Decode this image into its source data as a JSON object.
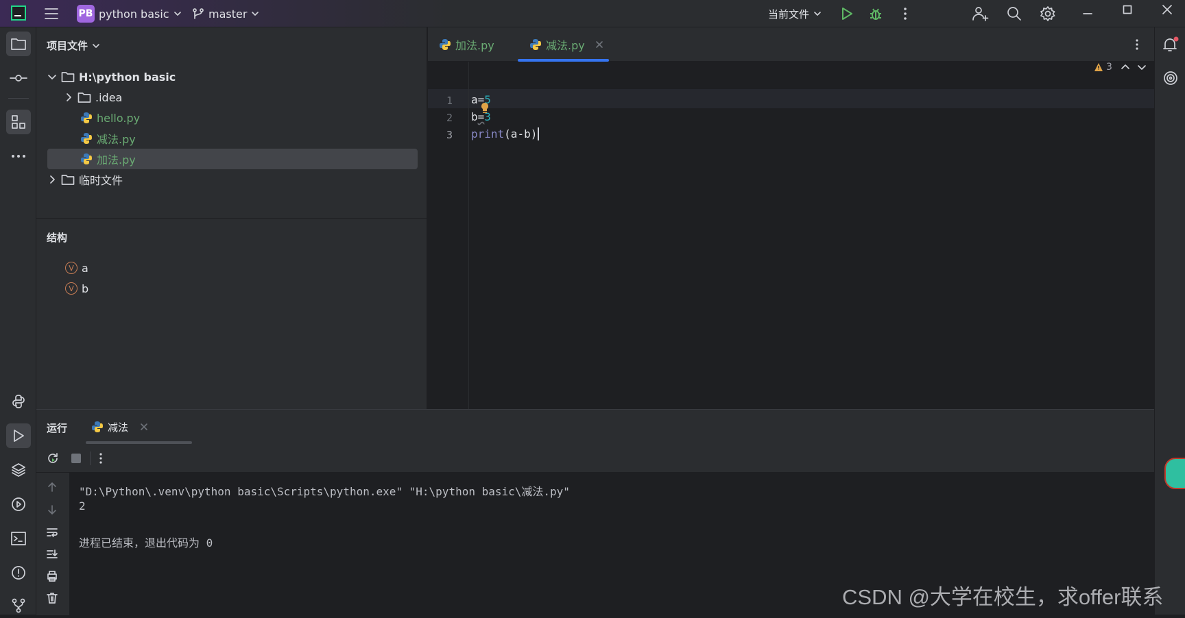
{
  "titlebar": {
    "project_badge": "PB",
    "project_name": "python basic",
    "branch": "master",
    "run_config": "当前文件"
  },
  "project_panel": {
    "title": "项目文件",
    "tree": {
      "root": "H:\\python basic",
      "idea": ".idea",
      "hello": "hello.py",
      "subtract": "减法.py",
      "add": "加法.py",
      "scratches": "临时文件"
    }
  },
  "structure_panel": {
    "title": "结构",
    "items": [
      "a",
      "b"
    ],
    "badge": "V"
  },
  "editor": {
    "tabs": [
      {
        "label": "加法.py"
      },
      {
        "label": "减法.py"
      }
    ],
    "warnings_count": "3",
    "line_numbers": [
      "1",
      "2",
      "3"
    ],
    "code": {
      "line1_var": "a",
      "line1_op": "=",
      "line1_val": "5",
      "line2_var": "b",
      "line2_op": "=",
      "line2_val": "3",
      "line3_fn": "print",
      "line3_args": "(a-b)"
    }
  },
  "run_panel": {
    "title": "运行",
    "tab_label": "减法",
    "output": [
      "\"D:\\Python\\.venv\\python basic\\Scripts\\python.exe\" \"H:\\python basic\\减法.py\"",
      "2",
      "",
      "进程已结束，退出代码为 0"
    ]
  },
  "watermark": "CSDN @大学在校生，求offer联系",
  "colors": {
    "bg_panel": "#2b2d30",
    "bg_editor": "#1e1f22",
    "accent": "#3574f0",
    "green_file": "#6aab73",
    "number": "#2aacb8",
    "builtin": "#8888c6",
    "warning": "#e0a347"
  }
}
